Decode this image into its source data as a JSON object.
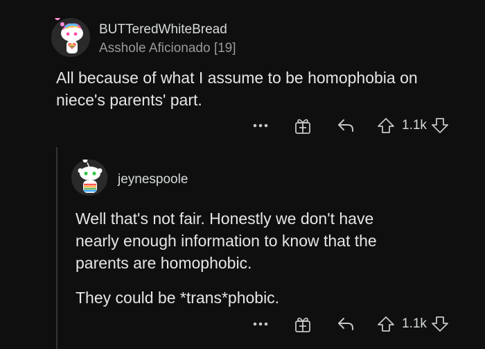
{
  "comments": [
    {
      "username": "BUTTeredWhiteBread",
      "flair": "Asshole Aficionado [19]",
      "lines": [
        "All because of what I assume to be homophobia on",
        "niece's parents' part."
      ],
      "votes": "1.1k",
      "icons": [
        "more-icon",
        "award-gift-icon",
        "reply-icon",
        "upvote-icon",
        "downvote-icon"
      ]
    },
    {
      "username": "jeynespoole",
      "paragraphs": [
        [
          "Well that's not fair. Honestly we don't have",
          "nearly enough information to know that the",
          "parents are homophobic."
        ],
        [
          "They could be *trans*phobic."
        ]
      ],
      "votes": "1.1k",
      "icons": [
        "more-icon",
        "award-gift-icon",
        "reply-icon",
        "upvote-icon",
        "downvote-icon"
      ]
    }
  ],
  "colors": {
    "background": "#0f0f0f",
    "text": "#e6e6e6",
    "meta": "#9a9a9c",
    "thread_line": "#343536"
  }
}
